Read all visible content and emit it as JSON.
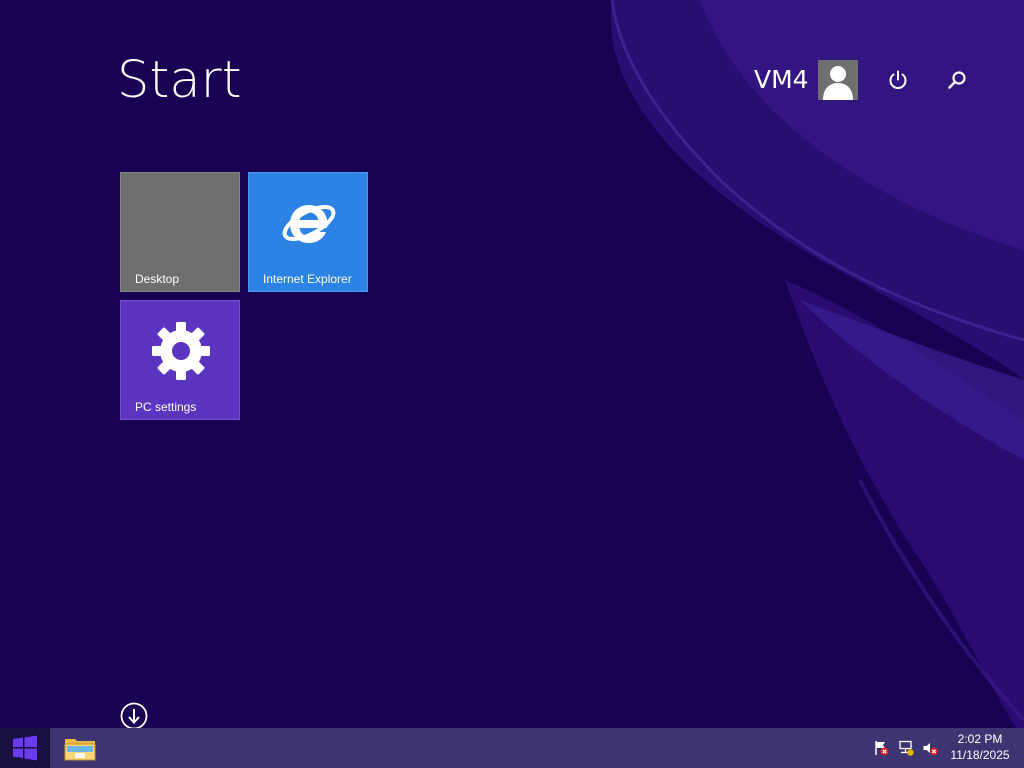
{
  "start_screen": {
    "title": "Start",
    "username": "VM4"
  },
  "tiles": [
    {
      "label": "Desktop",
      "color": "#6e6e6e",
      "icon": "none"
    },
    {
      "label": "Internet Explorer",
      "color": "#2d82e6",
      "icon": "internet-explorer-icon"
    },
    {
      "label": "PC settings",
      "color": "#5b34c0",
      "icon": "gear-icon"
    }
  ],
  "header_buttons": {
    "power_icon": "power-icon",
    "search_icon": "search-icon"
  },
  "taskbar": {
    "start_icon": "windows-logo-icon",
    "pinned": [
      "file-explorer-icon"
    ],
    "tray_icons": [
      "action-center-flag-icon",
      "network-icon",
      "volume-muted-icon"
    ],
    "clock": {
      "time": "2:02 PM",
      "date": "11/18/2025"
    }
  },
  "colors": {
    "background": "#180052",
    "accent": "#5b34c0",
    "taskbar": "#3d3571"
  }
}
